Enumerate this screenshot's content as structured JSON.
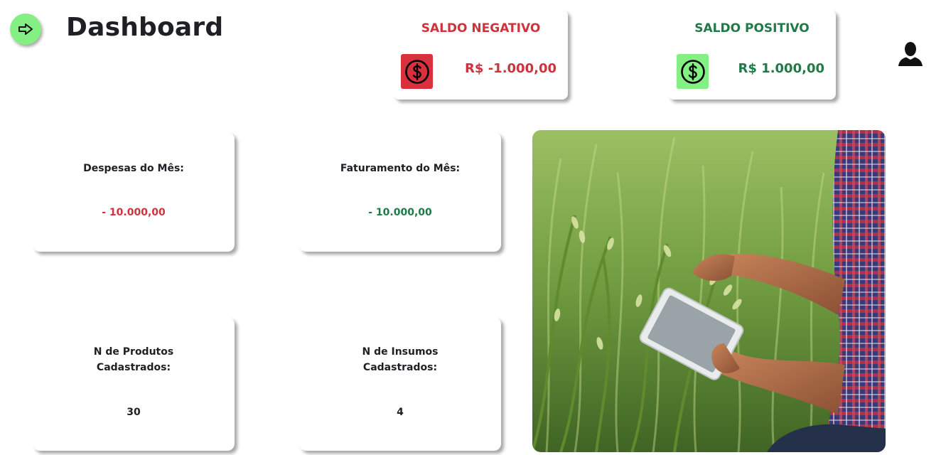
{
  "header": {
    "title": "Dashboard",
    "logout_icon": "arrow-right-icon",
    "user_icon": "user-icon"
  },
  "saldo": {
    "negative": {
      "title": "SALDO NEGATIVO",
      "value": "R$ -1.000,00",
      "icon": "dollar-circle-icon",
      "color": "#d0323c"
    },
    "positive": {
      "title": "SALDO POSITIVO",
      "value": "R$ 1.000,00",
      "icon": "dollar-circle-icon",
      "color": "#1f7a47"
    }
  },
  "stats": {
    "despesas": {
      "label": "Despesas do Mês:",
      "value": "- 10.000,00"
    },
    "faturamento": {
      "label": "Faturamento do Mês:",
      "value": "- 10.000,00"
    },
    "produtos": {
      "label": "N de Produtos Cadastrados:",
      "value": "30"
    },
    "insumos": {
      "label": "N de Insumos Cadastrados:",
      "value": "4"
    }
  },
  "colors": {
    "accent_green": "#84f084",
    "negative_red": "#d8303d",
    "positive_green": "#1f7a47"
  }
}
